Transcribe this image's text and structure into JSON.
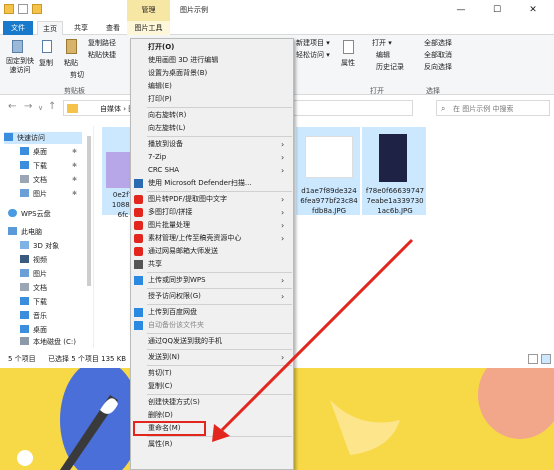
{
  "window": {
    "title": "图片示例",
    "manage_tab": "管理",
    "min_glyph": "—",
    "max_glyph": "☐",
    "close_glyph": "✕"
  },
  "tabs": [
    "文件",
    "主页",
    "共享",
    "查看",
    "图片工具"
  ],
  "ribbon": {
    "left_items": [
      "固定到快\n速访问",
      "复制",
      "粘贴",
      "复制路径",
      "粘贴快捷",
      "剪切"
    ],
    "clipboard_group": "剪贴板",
    "mid_items": [
      "新建项目 ▾",
      "轻松访问 ▾"
    ],
    "props_label": "属性",
    "open_items": [
      "打开 ▾",
      "编辑",
      "历史记录"
    ],
    "open_group": "打开",
    "select_items": [
      "全部选择",
      "全部取消",
      "反向选择"
    ],
    "select_group": "选择"
  },
  "address": {
    "crumb": "自媒体 › 图",
    "search_placeholder": "在 图片示例 中搜索"
  },
  "nav": {
    "quick_access": "快速访问",
    "items": [
      "桌面",
      "下载",
      "文档",
      "图片"
    ],
    "wps_cloud": "WPS云盘",
    "this_pc": "此电脑",
    "pc_items": [
      "3D 对象",
      "视频",
      "图片",
      "文档",
      "下载",
      "音乐",
      "桌面",
      "本地磁盘 (C:)"
    ]
  },
  "files": [
    {
      "caption": "0e2f7\n10889\n6fc"
    },
    {
      "caption": "d1ae7f89de324\n6fea977bf23c84\nfdb8a.JPG"
    },
    {
      "caption": "f78e0f66639747\n7eabe1a339730\n1ac6b.JPG"
    }
  ],
  "status": {
    "count": "5 个项目",
    "selected": "已选择 5 个项目  135 KB"
  },
  "context_menu": {
    "items": [
      {
        "label": "打开(O)",
        "bold": true
      },
      {
        "label": "使用画图 3D 进行编辑"
      },
      {
        "label": "设置为桌面背景(B)"
      },
      {
        "label": "编辑(E)"
      },
      {
        "label": "打印(P)"
      },
      {
        "sep": true
      },
      {
        "label": "向右旋转(R)"
      },
      {
        "label": "向左旋转(L)"
      },
      {
        "sep": true
      },
      {
        "label": "播放到设备",
        "sub": true
      },
      {
        "label": "7-Zip",
        "sub": true
      },
      {
        "label": "CRC SHA",
        "sub": true
      },
      {
        "label": "使用 Microsoft Defender扫描...",
        "icon": "defender-icon"
      },
      {
        "sep": true
      },
      {
        "label": "图片转PDF/提取图中文字",
        "icon": "wps-icon",
        "sub": true
      },
      {
        "label": "多图打印/拼接",
        "icon": "wps-icon",
        "sub": true
      },
      {
        "label": "图片批量处理",
        "icon": "wps-icon",
        "sub": true
      },
      {
        "label": "素材管理/上传至稿壳资源中心",
        "icon": "wps-icon",
        "sub": true
      },
      {
        "label": "通过网易邮箱大师发送",
        "icon": "mail-icon"
      },
      {
        "label": "共享",
        "icon": "share-icon"
      },
      {
        "sep": true
      },
      {
        "label": "上传或同步到WPS",
        "icon": "wps-cloud-icon",
        "sub": true
      },
      {
        "sep": true
      },
      {
        "label": "授予访问权限(G)",
        "sub": true
      },
      {
        "sep": true
      },
      {
        "label": "上传到百度网盘",
        "icon": "baidu-icon"
      },
      {
        "label": "自动备份该文件夹",
        "icon": "baidu-icon",
        "muted": true
      },
      {
        "sep": true
      },
      {
        "label": "通过QQ发送到我的手机"
      },
      {
        "sep": true
      },
      {
        "label": "发送到(N)",
        "sub": true
      },
      {
        "sep": true
      },
      {
        "label": "剪切(T)"
      },
      {
        "label": "复制(C)"
      },
      {
        "sep": true
      },
      {
        "label": "创建快捷方式(S)"
      },
      {
        "label": "删除(D)"
      },
      {
        "label": "重命名(M)",
        "highlight": true
      },
      {
        "sep": true
      },
      {
        "label": "属性(R)"
      }
    ]
  },
  "colors": {
    "accent": "#1979ca",
    "selection": "#cce8ff",
    "highlight_box": "#e2261e",
    "arrow": "#e2261e"
  }
}
